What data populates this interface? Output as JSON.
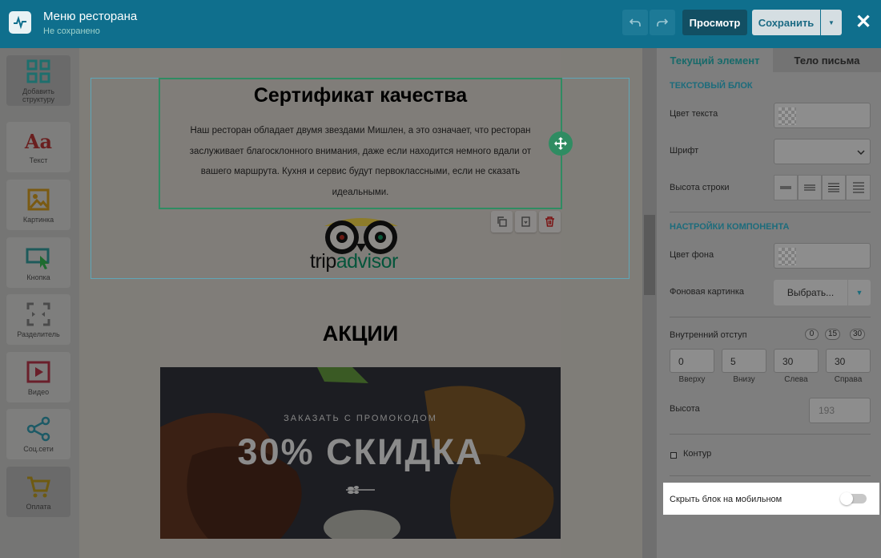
{
  "header": {
    "title": "Меню ресторана",
    "status": "Не сохранено",
    "preview_label": "Просмотр",
    "save_label": "Сохранить"
  },
  "tools": [
    {
      "label": "Добавить структуру",
      "icon": "grid-icon"
    },
    {
      "label": "Текст",
      "icon": "text-icon"
    },
    {
      "label": "Картинка",
      "icon": "image-icon"
    },
    {
      "label": "Кнопка",
      "icon": "button-icon"
    },
    {
      "label": "Разделитель",
      "icon": "divider-icon"
    },
    {
      "label": "Видео",
      "icon": "video-icon"
    },
    {
      "label": "Соц.сети",
      "icon": "share-icon"
    },
    {
      "label": "Оплата",
      "icon": "cart-icon"
    }
  ],
  "email": {
    "cert_title": "Сертификат качества",
    "cert_text": "Наш ресторан обладает двумя звездами Мишлен, а это означает, что ресторан заслуживает благосклонного внимания, даже если находится немного вдали от вашего маршрута. Кухня и сервис будут первоклассными, если не сказать идеальными.",
    "tripadvisor_trip": "trip",
    "tripadvisor_advisor": "advisor",
    "promo_heading": "АКЦИИ",
    "promo_subtitle": "ЗАКАЗАТЬ С ПРОМОКОДОМ",
    "promo_title": "30% СКИДКА"
  },
  "panel": {
    "tab_current": "Текущий элемент",
    "tab_body": "Тело письма",
    "text_block_section": "ТЕКСТОВЫЙ БЛОК",
    "text_color_label": "Цвет текста",
    "font_label": "Шрифт",
    "line_height_label": "Высота строки",
    "component_section": "НАСТРОЙКИ КОМПОНЕНТА",
    "bg_color_label": "Цвет фона",
    "bg_image_label": "Фоновая картинка",
    "choose_label": "Выбрать...",
    "padding_label": "Внутренний отступ",
    "padding_presets": [
      "0",
      "15",
      "30"
    ],
    "padding": [
      {
        "value": "0",
        "label": "Вверху"
      },
      {
        "value": "5",
        "label": "Внизу"
      },
      {
        "value": "30",
        "label": "Слева"
      },
      {
        "value": "30",
        "label": "Справа"
      }
    ],
    "height_label": "Высота",
    "height_value": "193",
    "border_label": "Контур",
    "hide_mobile_label": "Скрыть блок на мобильном"
  }
}
